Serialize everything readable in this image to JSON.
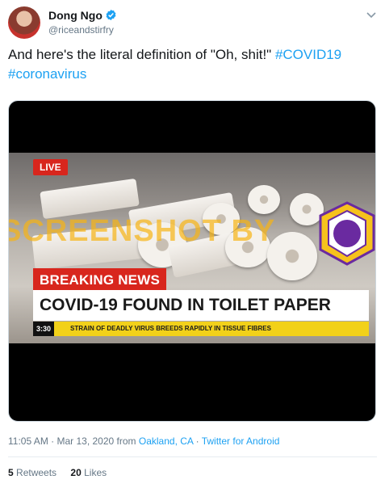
{
  "author": {
    "display_name": "Dong Ngo",
    "handle": "@riceandstirfry",
    "verified": true
  },
  "tweet": {
    "text_plain": "And here's the literal definition of \"Oh, shit!\" ",
    "hashtag_1": "#COVID19",
    "hashtag_2": "#coronavirus"
  },
  "media": {
    "live_label": "LIVE",
    "breaking_label": "BREAKING NEWS",
    "headline": "COVID-19 FOUND IN TOILET PAPER",
    "ticker_time": "3:30",
    "ticker_text": "STRAIN OF DEADLY VIRUS BREEDS RAPIDLY IN TISSUE FIBRES",
    "watermark": "SCREENSHOT BY",
    "stamp_top": "MASYARAKAT ANTI FITNAH INDONESIA",
    "stamp_center_1": "TURN",
    "stamp_center_2": "BACK",
    "stamp_center_3": "HOAX",
    "stamp_bottom": "MAFINDO"
  },
  "meta": {
    "time": "11:05 AM",
    "sep1": " · ",
    "date": "Mar 13, 2020",
    "from": " from ",
    "location": "Oakland, CA",
    "sep2": " · ",
    "client": "Twitter for Android"
  },
  "stats": {
    "retweets_count": "5",
    "retweets_label": "Retweets",
    "likes_count": "20",
    "likes_label": "Likes"
  },
  "colors": {
    "link": "#1da1f2",
    "breaking_red": "#d8261d",
    "ticker_yellow": "#f2d11a",
    "watermark": "#f6b414"
  }
}
